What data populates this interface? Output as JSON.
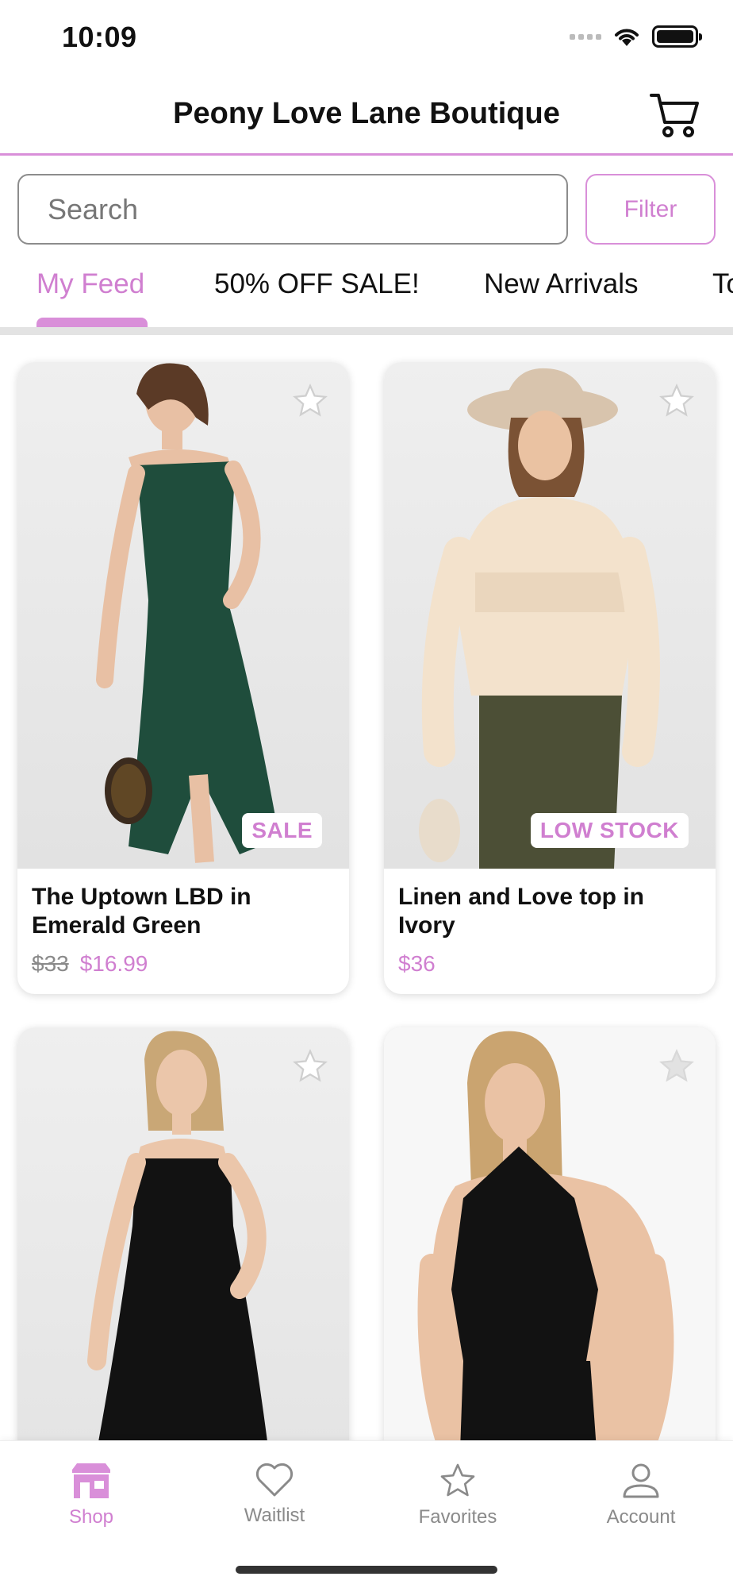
{
  "status_bar": {
    "time": "10:09"
  },
  "header": {
    "title": "Peony Love Lane Boutique",
    "cart_icon": "cart-icon"
  },
  "search": {
    "placeholder": "Search",
    "filter_label": "Filter"
  },
  "tabs": [
    {
      "label": "My Feed",
      "active": true
    },
    {
      "label": "50% OFF SALE!",
      "active": false
    },
    {
      "label": "New Arrivals",
      "active": false
    },
    {
      "label": "To",
      "active": false
    }
  ],
  "products": [
    {
      "title": "The Uptown LBD in Emerald Green",
      "price_old": "$33",
      "price": "$16.99",
      "badge": "SALE"
    },
    {
      "title": "Linen and Love top in Ivory",
      "price_old": "",
      "price": "$36",
      "badge": "LOW STOCK"
    },
    {
      "title": "",
      "price_old": "",
      "price": "",
      "badge": ""
    },
    {
      "title": "",
      "price_old": "",
      "price": "",
      "badge": ""
    }
  ],
  "bottom_nav": [
    {
      "label": "Shop",
      "icon": "shop-icon",
      "active": true
    },
    {
      "label": "Waitlist",
      "icon": "heart-icon",
      "active": false
    },
    {
      "label": "Favorites",
      "icon": "star-icon",
      "active": false
    },
    {
      "label": "Account",
      "icon": "account-icon",
      "active": false
    }
  ],
  "colors": {
    "accent": "#d07fd0",
    "accent_border": "#d98fd9"
  }
}
